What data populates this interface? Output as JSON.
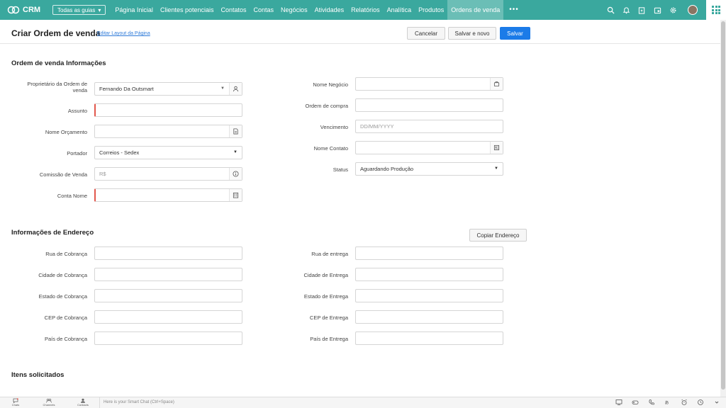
{
  "app": {
    "name": "CRM"
  },
  "topbar": {
    "all_modules": "Todas as guias",
    "nav_items": [
      "Página Inicial",
      "Clientes potenciais",
      "Contatos",
      "Contas",
      "Negócios",
      "Atividades",
      "Relatórios",
      "Analítica",
      "Produtos",
      "Ordens de venda"
    ],
    "active_index": 9,
    "more": "•••",
    "icons": [
      "search-icon",
      "bell-icon",
      "add-record-icon",
      "calendar-icon",
      "gear-icon",
      "avatar",
      "apps-grid-icon"
    ]
  },
  "header": {
    "title": "Criar Ordem de venda",
    "edit_layout": "Editar Layout da Página",
    "cancel": "Cancelar",
    "save_new": "Salvar e novo",
    "save": "Salvar"
  },
  "sections": {
    "order_info": "Ordem de venda Informações",
    "address_info": "Informações de Endereço",
    "items": "Itens solicitados",
    "copy_address": "Copiar Endereço"
  },
  "order_left": [
    {
      "label": "Proprietário da Ordem de venda",
      "value": "Fernando Da Outsmart",
      "placeholder": ""
    },
    {
      "label": "Assunto",
      "value": "",
      "placeholder": ""
    },
    {
      "label": "Nome Orçamento",
      "value": "",
      "placeholder": ""
    },
    {
      "label": "Portador",
      "value": "Correios - Sedex",
      "placeholder": ""
    },
    {
      "label": "Comissão de Venda",
      "value": "",
      "placeholder": "R$"
    },
    {
      "label": "Conta Nome",
      "value": "",
      "placeholder": ""
    }
  ],
  "order_right": [
    {
      "label": "Nome Negócio",
      "value": "",
      "placeholder": ""
    },
    {
      "label": "Ordem de compra",
      "value": "",
      "placeholder": ""
    },
    {
      "label": "Vencimento",
      "value": "",
      "placeholder": "DD/MM/YYYY"
    },
    {
      "label": "Nome Contato",
      "value": "",
      "placeholder": ""
    },
    {
      "label": "Status",
      "value": "Aguardando Produção",
      "placeholder": ""
    }
  ],
  "address_left": [
    {
      "label": "Rua de Cobrança"
    },
    {
      "label": "Cidade de Cobrança"
    },
    {
      "label": "Estado de Cobrança"
    },
    {
      "label": "CEP de Cobrança"
    },
    {
      "label": "País de Cobrança"
    }
  ],
  "address_right": [
    {
      "label": "Rua de entrega"
    },
    {
      "label": "Cidade de Entrega"
    },
    {
      "label": "Estado de Entrega"
    },
    {
      "label": "CEP de Entrega"
    },
    {
      "label": "País de Entrega"
    }
  ],
  "bottombar": {
    "items": [
      "Chats",
      "Channels",
      "Contacts"
    ],
    "smart_chat": "Here is your Smart Chat (Ctrl+Space)"
  },
  "colors": {
    "brand": "#3aa89e",
    "primary_button": "#1b7be8",
    "required": "#e2574c"
  }
}
